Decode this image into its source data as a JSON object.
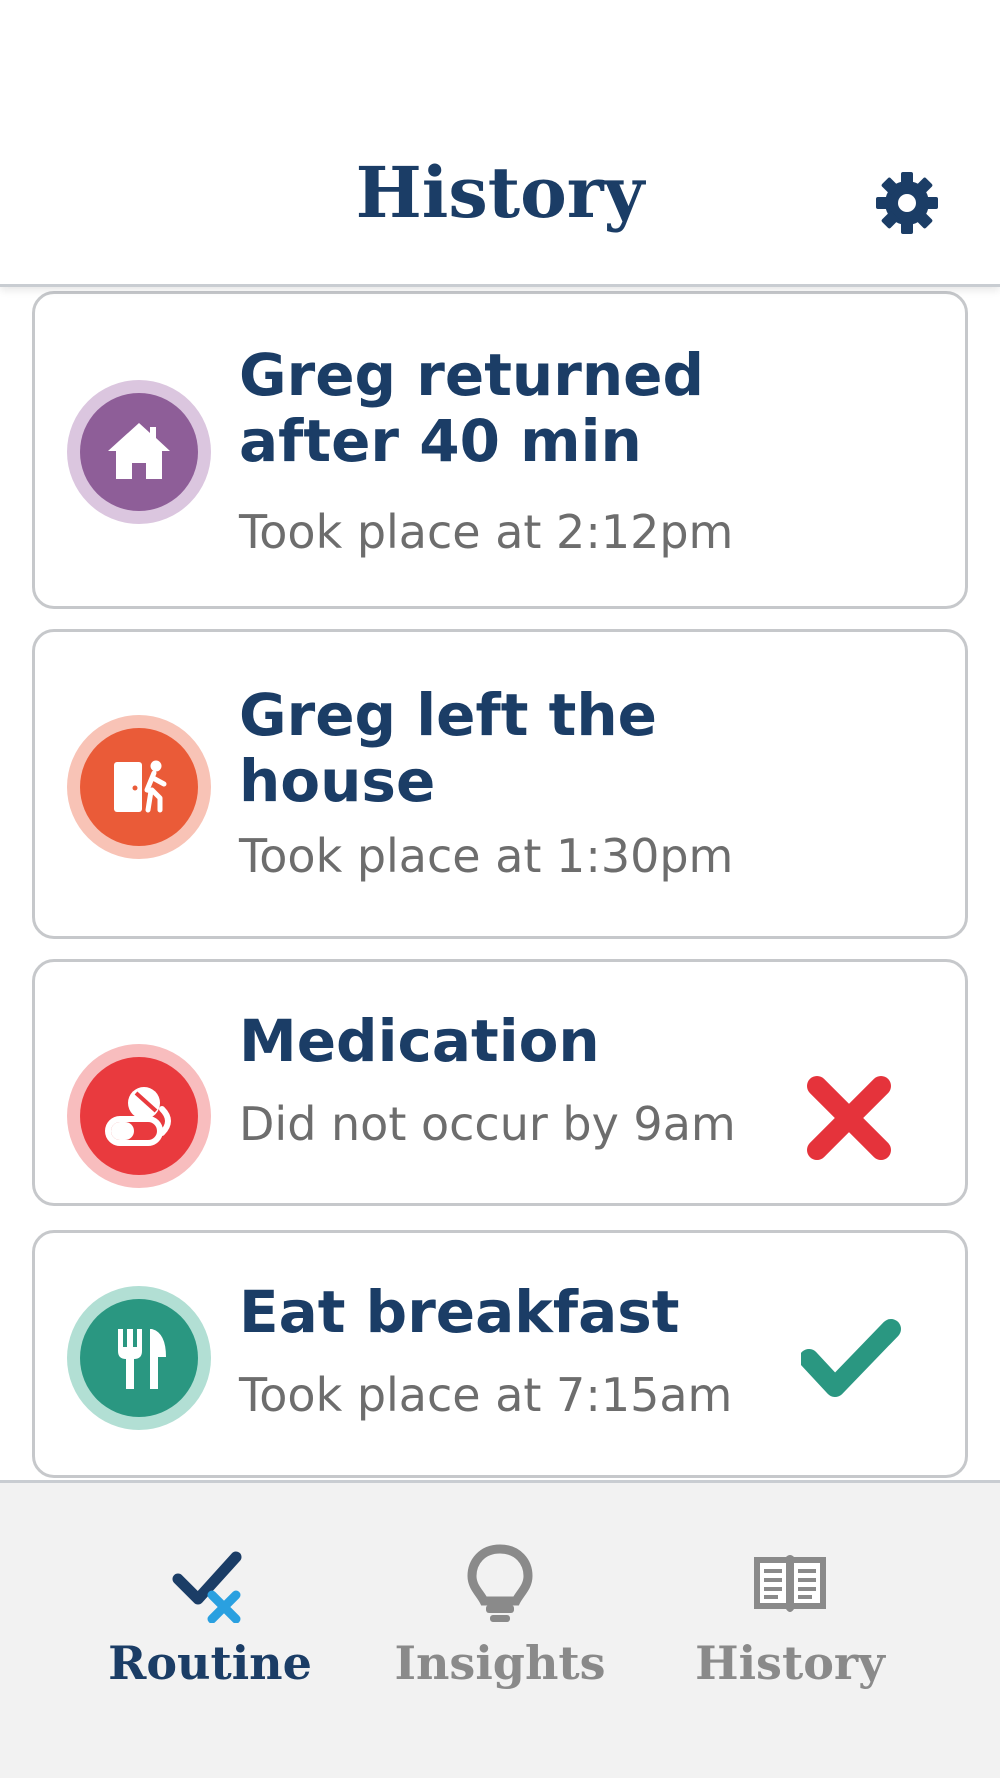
{
  "header": {
    "title": "History",
    "settings_icon": "gear-icon"
  },
  "history": [
    {
      "icon": "house-icon",
      "icon_color": "#8e5e98",
      "icon_ring": "#dbc6df",
      "title": "Greg returned after 40 min",
      "subtitle": "Took place at 2:12pm",
      "status": null
    },
    {
      "icon": "exit-door-icon",
      "icon_color": "#ea5b38",
      "icon_ring": "#f8c3b6",
      "title": "Greg left the house",
      "subtitle": "Took place at 1:30pm",
      "status": null
    },
    {
      "icon": "pill-icon",
      "icon_color": "#e93a3e",
      "icon_ring": "#f8bdbe",
      "title": "Medication",
      "subtitle": "Did not occur by 9am",
      "status": "missed",
      "status_icon": "x-mark-icon",
      "status_color": "#e5333b"
    },
    {
      "icon": "fork-knife-icon",
      "icon_color": "#2a9781",
      "icon_ring": "#b2dfd4",
      "title": "Eat breakfast",
      "subtitle": "Took place at 7:15am",
      "status": "done",
      "status_icon": "checkmark-icon",
      "status_color": "#2a9781"
    }
  ],
  "bottom_nav": {
    "items": [
      {
        "label": "Routine",
        "icon": "routine-check-icon",
        "active": true
      },
      {
        "label": "Insights",
        "icon": "lightbulb-icon",
        "active": false
      },
      {
        "label": "History",
        "icon": "book-icon",
        "active": false
      }
    ],
    "active_color": "#1b3d66",
    "inactive_color": "#8a8a8a"
  }
}
